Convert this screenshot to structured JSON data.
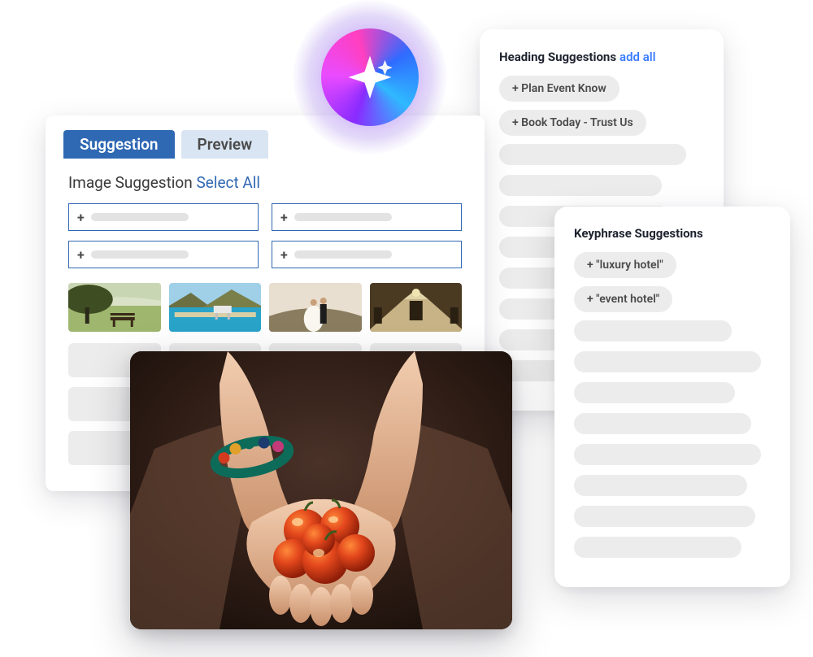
{
  "heading_card": {
    "title": "Heading Suggestions",
    "add_all": "add all",
    "items": [
      "+ Plan Event Know",
      "+ Book Today - Trust Us"
    ]
  },
  "keyphrase_card": {
    "title": "Keyphrase Suggestions",
    "items": [
      "+ \"luxury hotel\"",
      "+ \"event hotel\""
    ]
  },
  "main_panel": {
    "tabs": {
      "active": "Suggestion",
      "inactive": "Preview"
    },
    "image_suggestion": {
      "title": "Image Suggestion",
      "select_all": "Select All"
    }
  },
  "icons": {
    "sparkle": "sparkle-icon",
    "plus": "+"
  }
}
